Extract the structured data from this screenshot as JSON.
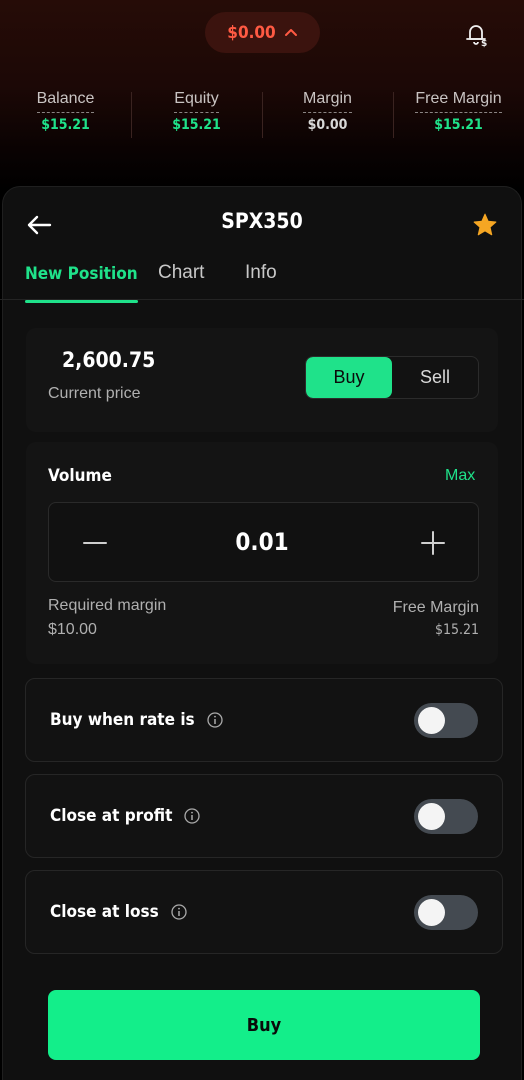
{
  "header": {
    "balance_pill": "$0.00",
    "stats": [
      {
        "label": "Balance",
        "value": "$15.21"
      },
      {
        "label": "Equity",
        "value": "$15.21"
      },
      {
        "label": "Margin",
        "value": "$0.00"
      },
      {
        "label": "Free Margin",
        "value": "$15.21"
      }
    ]
  },
  "instrument": {
    "symbol": "SPX350",
    "favorite": true
  },
  "tabs": [
    "New Position",
    "Chart",
    "Info"
  ],
  "active_tab": "New Position",
  "price_card": {
    "price": "2,600.75",
    "label": "Current price",
    "buy_label": "Buy",
    "sell_label": "Sell",
    "selected_side": "Buy"
  },
  "volume": {
    "label": "Volume",
    "max_label": "Max",
    "value": "0.01",
    "required_margin_label": "Required margin",
    "required_margin_value": "$10.00",
    "free_margin_label": "Free Margin",
    "free_margin_value": "$15.21"
  },
  "toggles": [
    {
      "label": "Buy when rate is",
      "on": false
    },
    {
      "label": "Close at profit",
      "on": false
    },
    {
      "label": "Close at loss",
      "on": false
    }
  ],
  "submit_label": "Buy",
  "colors": {
    "accent_green": "#1fe28a",
    "loss_red": "#ff5a43",
    "star": "#f5a623"
  }
}
